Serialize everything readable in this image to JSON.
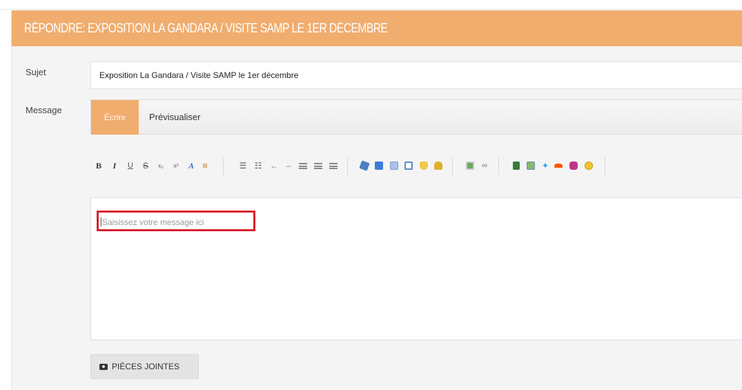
{
  "header": {
    "title": "RÉPONDRE: EXPOSITION LA GANDARA / VISITE SAMP LE 1ER DÉCEMBRE"
  },
  "form": {
    "subject_label": "Sujet",
    "subject_value": "Exposition La Gandara / Visite SAMP le 1er décembre",
    "message_label": "Message",
    "tabs": {
      "write": "Écrire",
      "preview": "Prévisualiser"
    },
    "editor_placeholder": "Saisissez votre message ici",
    "attach_label": "PIÈCES JOINTES"
  },
  "toolbar": {
    "bold": "B",
    "italic": "I",
    "underline": "U",
    "strike": "S",
    "subscript": "x₂",
    "superscript": "x²",
    "font_color": "A",
    "remove_format": "⊞",
    "bullet_list": "☰",
    "number_list": "☷",
    "outdent": "←",
    "indent": "–",
    "twitter": "🐦"
  },
  "icons": [
    "bold-icon",
    "italic-icon",
    "underline-icon",
    "strikethrough-icon",
    "subscript-icon",
    "superscript-icon",
    "font-color-icon",
    "remove-format-icon",
    "bullet-list-icon",
    "numbered-list-icon",
    "outdent-icon",
    "indent-icon",
    "align-left-icon",
    "align-center-icon",
    "align-right-icon",
    "spoiler-icon",
    "quote-icon",
    "table-icon",
    "window-icon",
    "shield-icon",
    "lock-icon",
    "image-icon",
    "link-icon",
    "video-icon",
    "gallery-icon",
    "twitter-icon",
    "soundcloud-icon",
    "instagram-icon",
    "emoji-icon",
    "camera-icon"
  ],
  "colors": {
    "accent": "#f0ad6e",
    "highlight_box": "#d8212e",
    "twitter": "#1da1f2",
    "soundcloud": "#ff5500",
    "instagram": "#c13584"
  }
}
